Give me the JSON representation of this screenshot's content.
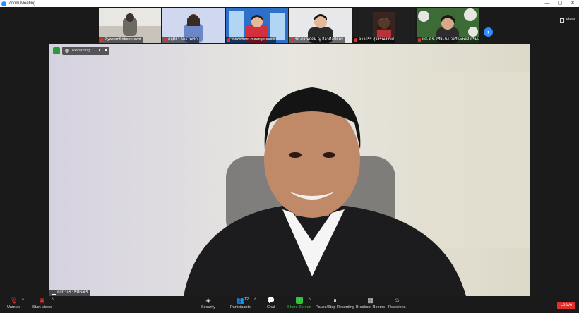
{
  "window": {
    "title": "Zoom Meeting",
    "controls": [
      "—",
      "▢",
      "✕"
    ]
  },
  "strip": {
    "participants": [
      {
        "name": "JiyapornSriboonrawd",
        "colors": [
          "#6d6a63",
          "#e9e7e3"
        ]
      },
      {
        "name": "กฤติยา โยธไพเรา",
        "colors": [
          "#6b87c7",
          "#cfd8ee"
        ]
      },
      {
        "name": "suwamern.moungprasert",
        "colors": [
          "#2e6fc9",
          "#b1d6f3"
        ]
      },
      {
        "name": "รศ.ดร.นฤดม ญ ลีลาศิลป์ยตร",
        "colors": [
          "#e8e8ea",
          "#2a2a2a"
        ]
      },
      {
        "name": "อาจารีร่ สุวรรณรงษต์",
        "colors": [
          "#3a2420",
          "#c28c6a"
        ]
      },
      {
        "name": "ผศ. ดร. ศรีระนา วงศ์แพพงษ์ ศรีมแพร",
        "colors": [
          "#3d6b35",
          "#e7e6e2"
        ]
      }
    ],
    "view_label": "View"
  },
  "main_video": {
    "recording_label": "Recording...",
    "pause_glyph": "⏸",
    "stop_glyph": "■",
    "speaker_name": "ยุกนำกร ปรีดีเมตร์"
  },
  "toolbar": {
    "unmute": "Unmute",
    "start_video": "Start Video",
    "security": "Security",
    "participants": "Participants",
    "participants_count": "12",
    "chat": "Chat",
    "share_screen": "Share Screen",
    "pause_stop_recording": "Pause/Stop Recording",
    "breakout_rooms": "Breakout Rooms",
    "reactions": "Reactions",
    "leave": "Leave"
  },
  "colors": {
    "accent": "#2d8cff",
    "leave": "#e0302e",
    "share": "#37c03f",
    "mic_off": "#e0302e"
  },
  "icons": {
    "unmute": "microphone-muted-icon",
    "start_video": "camera-off-icon",
    "security": "shield-icon",
    "participants": "people-icon",
    "chat": "chat-bubble-icon",
    "share": "share-arrow-icon",
    "recording": "pause-stop-icon",
    "breakout": "grid-icon",
    "reactions": "smiley-icon"
  }
}
